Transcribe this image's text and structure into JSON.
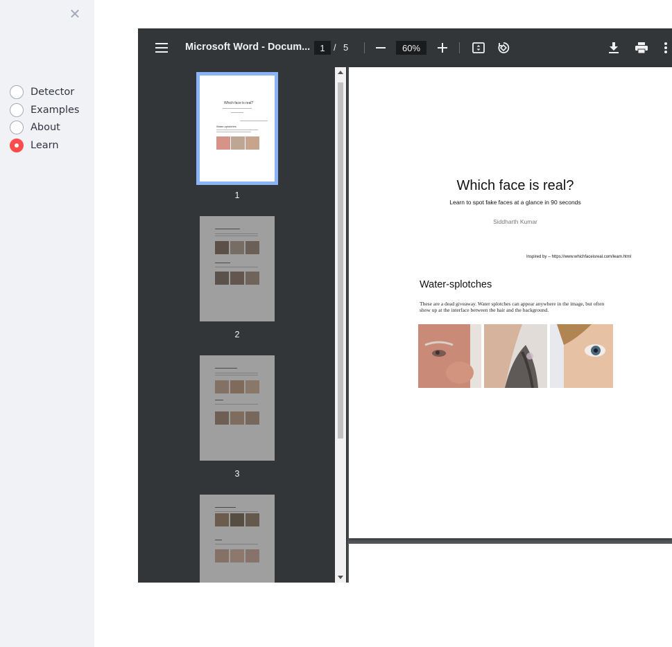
{
  "sidebar": {
    "close_glyph": "✕",
    "options": [
      {
        "label": "Detector",
        "selected": false
      },
      {
        "label": "Examples",
        "selected": false
      },
      {
        "label": "About",
        "selected": false
      },
      {
        "label": "Learn",
        "selected": true
      }
    ]
  },
  "viewer": {
    "title": "Microsoft Word - Docum...",
    "current_page": "1",
    "page_separator": "/",
    "total_pages": "5",
    "zoom": "60%",
    "icons": [
      "menu-icon",
      "zoom-out-icon",
      "zoom-in-icon",
      "fit-page-icon",
      "rotate-icon",
      "download-icon",
      "print-icon",
      "more-icon"
    ]
  },
  "thumbnails": [
    {
      "number": "1",
      "selected": true
    },
    {
      "number": "2",
      "selected": false
    },
    {
      "number": "3",
      "selected": false
    },
    {
      "number": ""
    }
  ],
  "document": {
    "title": "Which face is real?",
    "subtitle": "Learn to spot fake faces at a glance in 90 seconds",
    "author": "Siddharth Kumar",
    "inspired": "Inspired by -- https://www.whichfaceisreal.com/learn.html",
    "section_heading": "Water-splotches",
    "section_text": "These are a dead giveaway. Water splotches can appear anywhere in the image, but often show up at the interface between the hair and the background."
  },
  "colors": {
    "accent": "#ff4b4b",
    "sidebar_bg": "#f0f2f6",
    "toolbar_bg": "#323639",
    "thumb_selected": "#8ab4f8"
  }
}
